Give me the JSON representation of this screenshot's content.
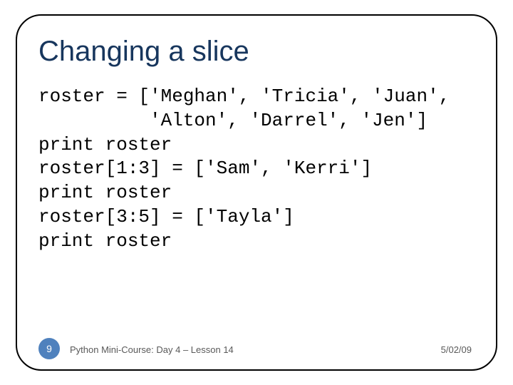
{
  "title": "Changing a slice",
  "code_lines": {
    "l1": "roster = ['Meghan', 'Tricia', 'Juan',",
    "l2": "          'Alton', 'Darrel', 'Jen']",
    "l3": "print roster",
    "l4": "roster[1:3] = ['Sam', 'Kerri']",
    "l5": "print roster",
    "l6": "roster[3:5] = ['Tayla']",
    "l7": "print roster"
  },
  "footer": {
    "page_number": "9",
    "course": "Python Mini-Course: Day 4 – Lesson 14",
    "date": "5/02/09"
  }
}
